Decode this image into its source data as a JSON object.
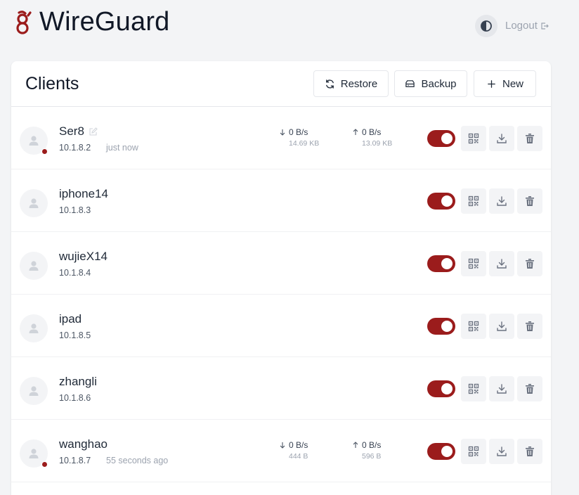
{
  "app": {
    "title": "WireGuard",
    "logout_label": "Logout",
    "accent": "#9b1c1c"
  },
  "clients_panel": {
    "title": "Clients",
    "restore_label": "Restore",
    "backup_label": "Backup",
    "new_label": "New"
  },
  "icons": {
    "logo": "wireguard-logo",
    "theme": "contrast-icon",
    "logout": "logout-icon",
    "restore": "refresh-icon",
    "backup": "database-icon",
    "new": "plus-icon",
    "avatar": "user-icon",
    "edit": "edit-icon",
    "qr": "qr-code-icon",
    "download": "download-icon",
    "delete": "trash-icon",
    "down": "arrow-down-icon",
    "up": "arrow-up-icon"
  },
  "clients": [
    {
      "name": "Ser8",
      "ip": "10.1.8.2",
      "last_seen": "just now",
      "online": true,
      "enabled": true,
      "rx_rate": "0 B/s",
      "rx_total": "14.69 KB",
      "tx_rate": "0 B/s",
      "tx_total": "13.09 KB"
    },
    {
      "name": "iphone14",
      "ip": "10.1.8.3",
      "enabled": true
    },
    {
      "name": "wujieX14",
      "ip": "10.1.8.4",
      "enabled": true
    },
    {
      "name": "ipad",
      "ip": "10.1.8.5",
      "enabled": true
    },
    {
      "name": "zhangli",
      "ip": "10.1.8.6",
      "enabled": true
    },
    {
      "name": "wanghao",
      "ip": "10.1.8.7",
      "last_seen": "55 seconds ago",
      "online": true,
      "enabled": true,
      "rx_rate": "0 B/s",
      "rx_total": "444 B",
      "tx_rate": "0 B/s",
      "tx_total": "596 B"
    }
  ]
}
